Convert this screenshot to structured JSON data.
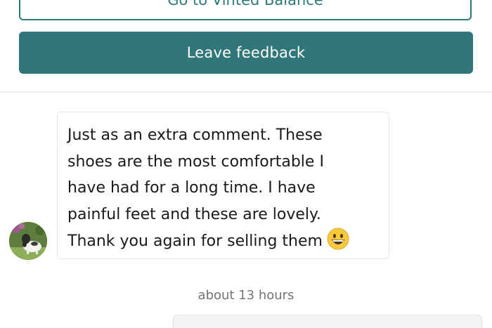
{
  "actions": {
    "balance_label": "Go to Vinted Balance",
    "feedback_label": "Leave feedback"
  },
  "message": {
    "lines": [
      "Just as an extra comment. These",
      "shoes are the most comfortable I",
      "have had for a long time. I have",
      "painful feet and these are lovely.",
      "Thank you again for selling them"
    ],
    "emoji": "grinning-face-emoji",
    "avatar": "user-avatar-dog-photo"
  },
  "timestamp": "about 13 hours",
  "colors": {
    "accent": "#317679",
    "border": "#e6e6e6",
    "muted_text": "#737373"
  }
}
